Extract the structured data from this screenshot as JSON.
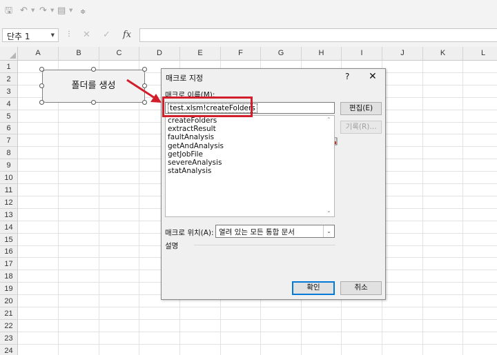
{
  "name_box": {
    "value": "단추 1"
  },
  "formula_bar": {
    "fx_symbol": "fx",
    "cancel_symbol": "✕",
    "enter_symbol": "✓",
    "value": ""
  },
  "columns": [
    "A",
    "B",
    "C",
    "D",
    "E",
    "F",
    "G",
    "H",
    "I",
    "J",
    "K",
    "L"
  ],
  "rows": [
    "1",
    "2",
    "3",
    "4",
    "5",
    "6",
    "7",
    "8",
    "9",
    "10",
    "11",
    "12",
    "13",
    "14",
    "15",
    "16",
    "17",
    "18",
    "19",
    "20",
    "21",
    "22",
    "23",
    "24"
  ],
  "shape": {
    "label": "폴더를 생성"
  },
  "dialog": {
    "title": "매크로 지정",
    "help": "?",
    "close": "✕",
    "macro_name_label": "매크로 이름(M):",
    "macro_name_value": "test.xlsm!createFolders",
    "macros": [
      "createFolders",
      "extractResult",
      "faultAnalysis",
      "getAndAnalysis",
      "getJobFile",
      "severeAnalysis",
      "statAnalysis"
    ],
    "edit_button": "편집(E)",
    "record_button": "기록(R)...",
    "location_label": "매크로 위치(A):",
    "location_value": "열려 있는 모든 통합 문서",
    "description_label": "설명",
    "ok_button": "확인",
    "cancel_button": "취소"
  },
  "colors": {
    "annotation": "#d21e2b",
    "default_button_border": "#0078d7"
  }
}
